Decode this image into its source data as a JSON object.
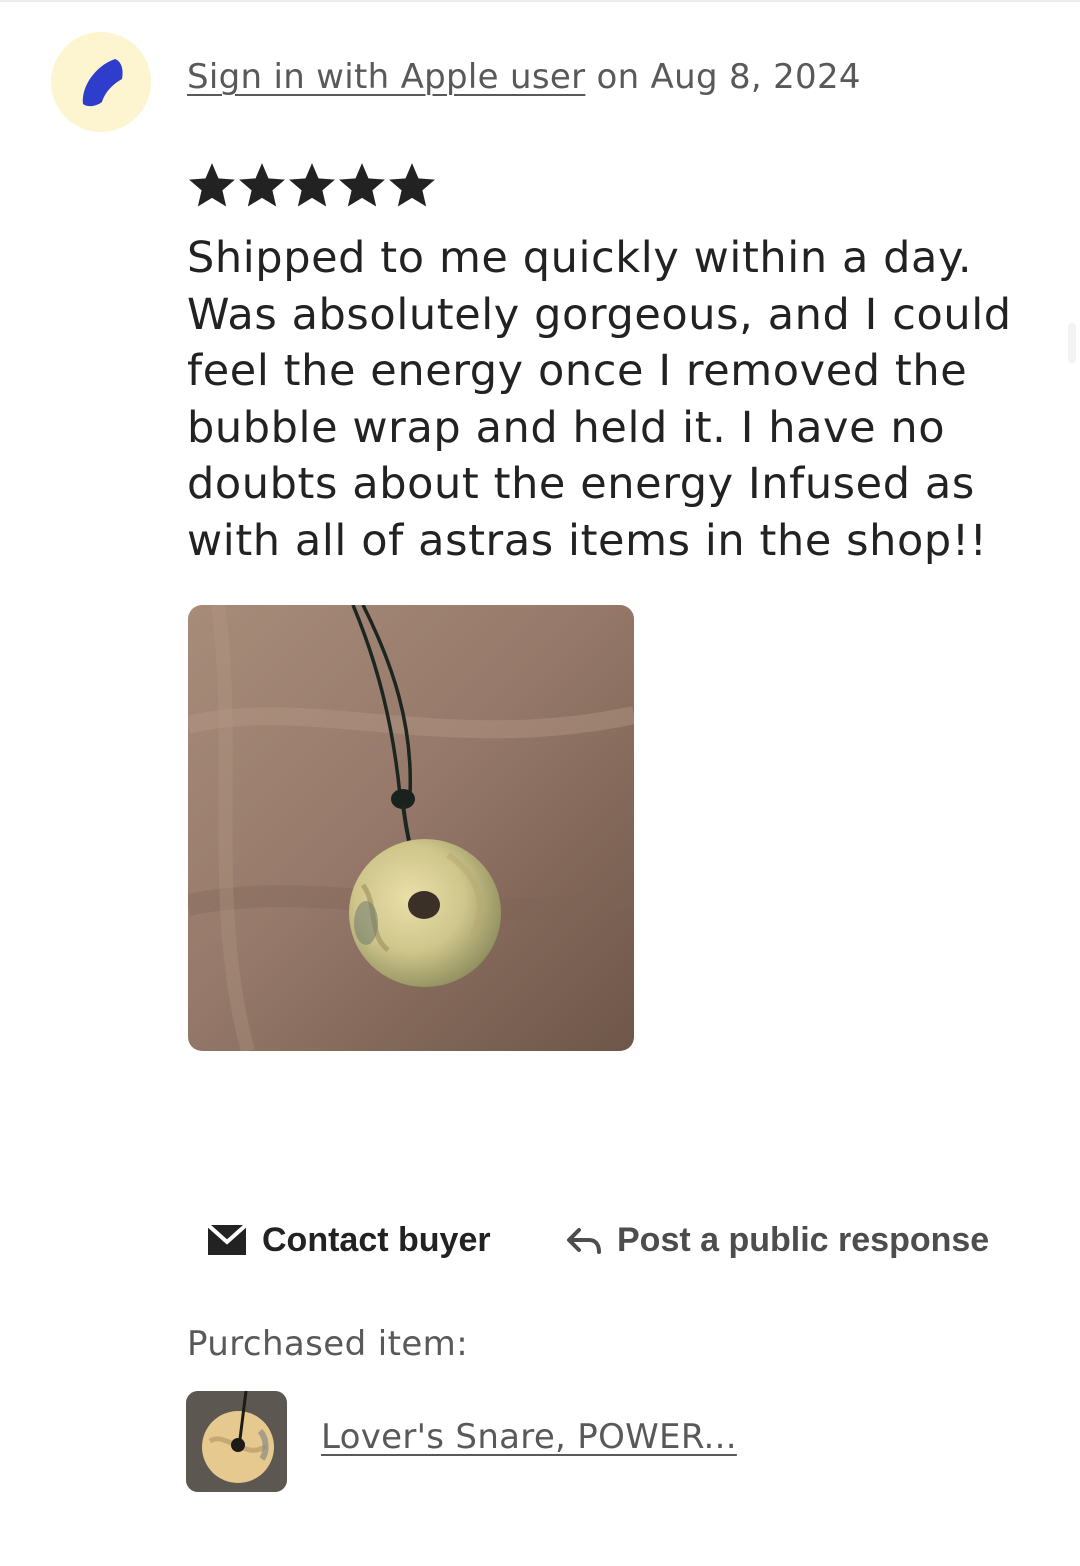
{
  "review": {
    "reviewer_name": "Sign in with Apple user",
    "date_text": " on Aug 8, 2024",
    "rating": 5,
    "rating_max": 5,
    "star_color": "#222222",
    "text": "Shipped to me quickly within a day. Was absolutely gorgeous, and I could feel the energy once I removed the bubble wrap and held it. I have no doubts about the energy Infused as with all of astras items in the shop!!"
  },
  "avatar": {
    "background": "#fdf5cf",
    "glyph_color": "#2f3dcc",
    "icon": "crescent-moon-icon"
  },
  "actions": {
    "contact_label": "Contact buyer",
    "contact_icon": "mail-icon",
    "respond_label": "Post a public response",
    "respond_icon": "reply-arrow-icon"
  },
  "purchased": {
    "label": "Purchased item:",
    "item_title": "Lover's Snare, POWER..."
  }
}
